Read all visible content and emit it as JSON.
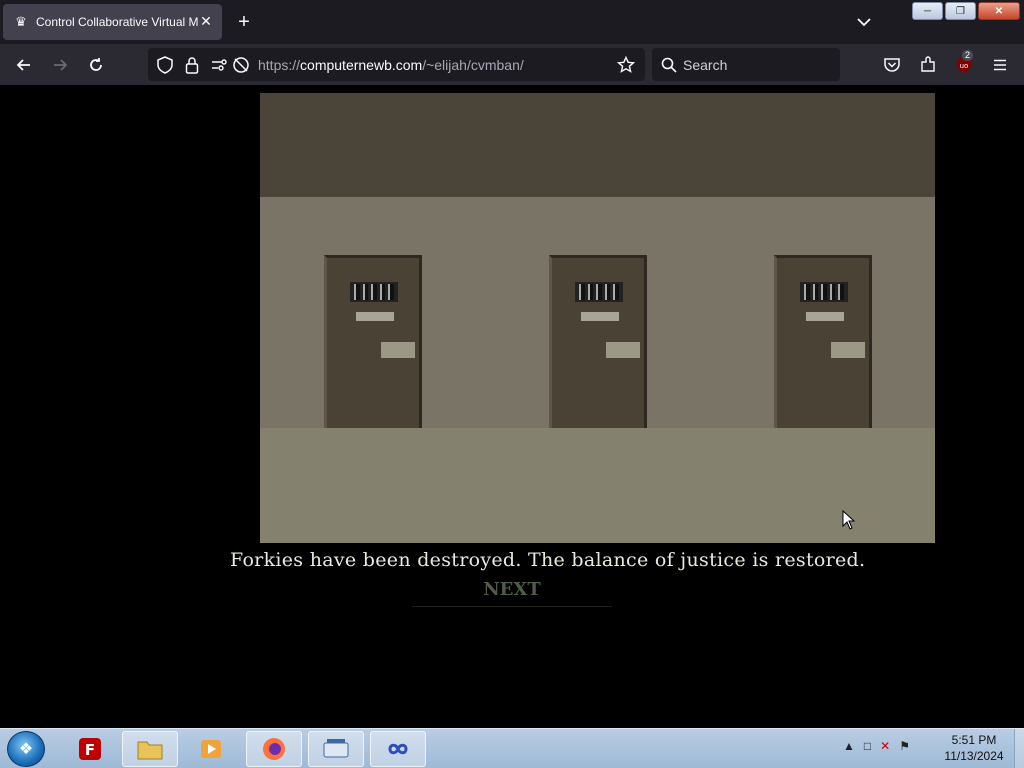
{
  "browser": {
    "tab_title": "Control Collaborative Virtual M",
    "url_protocol": "https://",
    "url_host": "computernewb.com",
    "url_path": "/~elijah/cvmban/",
    "search_placeholder": "Search",
    "extension_badge": "2"
  },
  "game": {
    "caption": "Forkies have been destroyed. The balance of justice is restored.",
    "next_label": "NEXT"
  },
  "taskbar": {
    "time": "5:51 PM",
    "date": "11/13/2024"
  },
  "colors": {
    "ceiling": "#4a4439",
    "wall": "#797465",
    "floor": "#85816f",
    "door": "#4b4236",
    "caption_text": "#ece9d8",
    "next_text": "#4f5c4b"
  }
}
